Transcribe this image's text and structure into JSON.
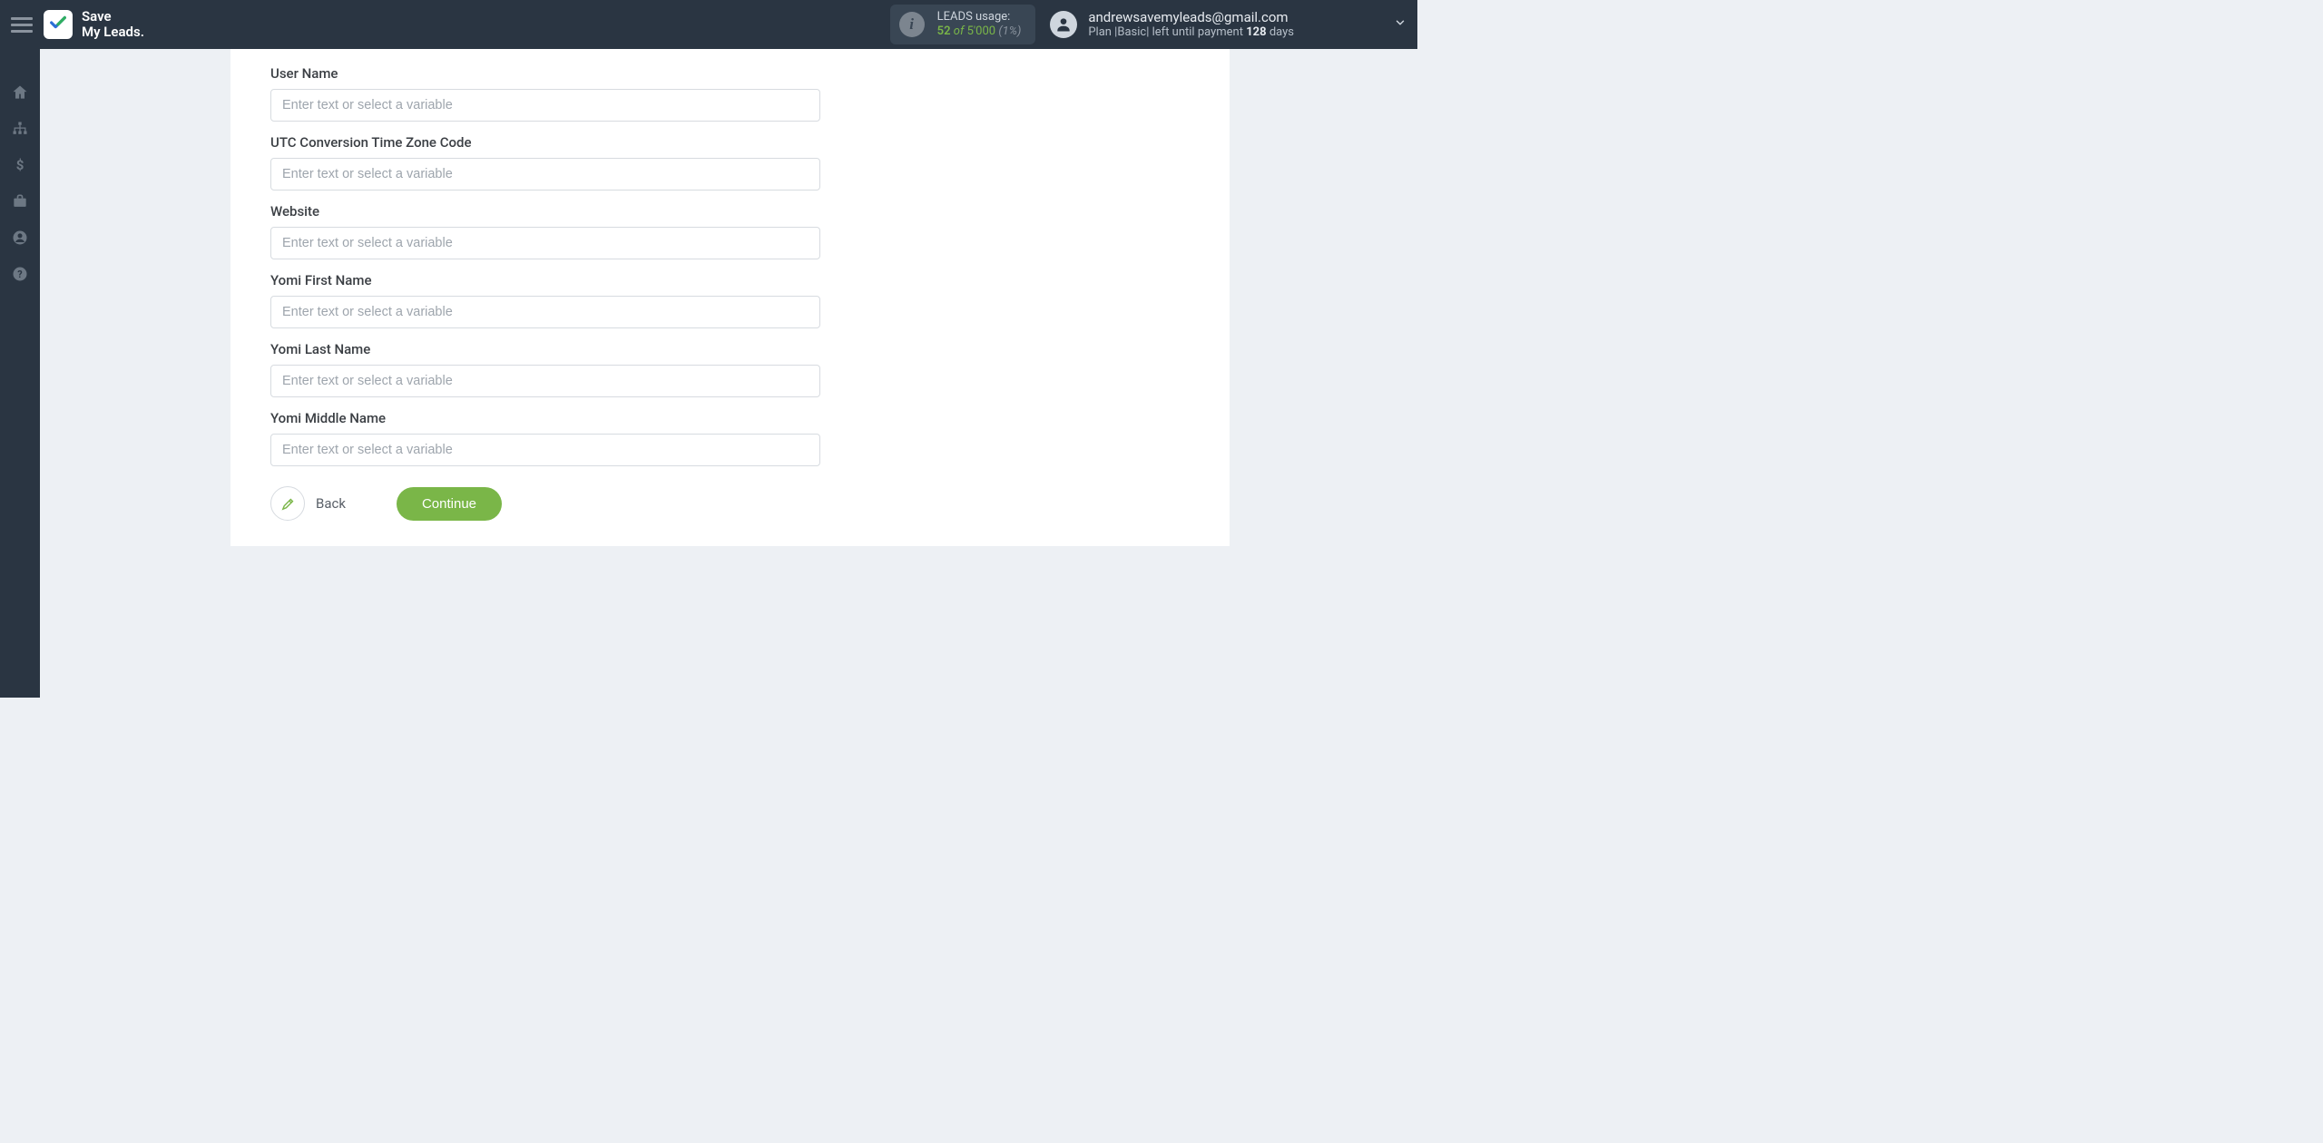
{
  "brand": {
    "line1": "Save",
    "line2": "My Leads."
  },
  "header": {
    "usage": {
      "label": "LEADS usage:",
      "used": "52",
      "of": "of",
      "total": "5'000",
      "pct": "(1%)"
    },
    "account": {
      "email": "andrewsavemyleads@gmail.com",
      "plan_prefix": "Plan |",
      "plan_name": "Basic",
      "plan_mid": "| left until payment ",
      "days": "128",
      "days_suffix": " days"
    }
  },
  "form": {
    "placeholder": "Enter text or select a variable",
    "fields": [
      {
        "label": "User Name"
      },
      {
        "label": "UTC Conversion Time Zone Code"
      },
      {
        "label": "Website"
      },
      {
        "label": "Yomi First Name"
      },
      {
        "label": "Yomi Last Name"
      },
      {
        "label": "Yomi Middle Name"
      }
    ],
    "back_label": "Back",
    "continue_label": "Continue"
  }
}
